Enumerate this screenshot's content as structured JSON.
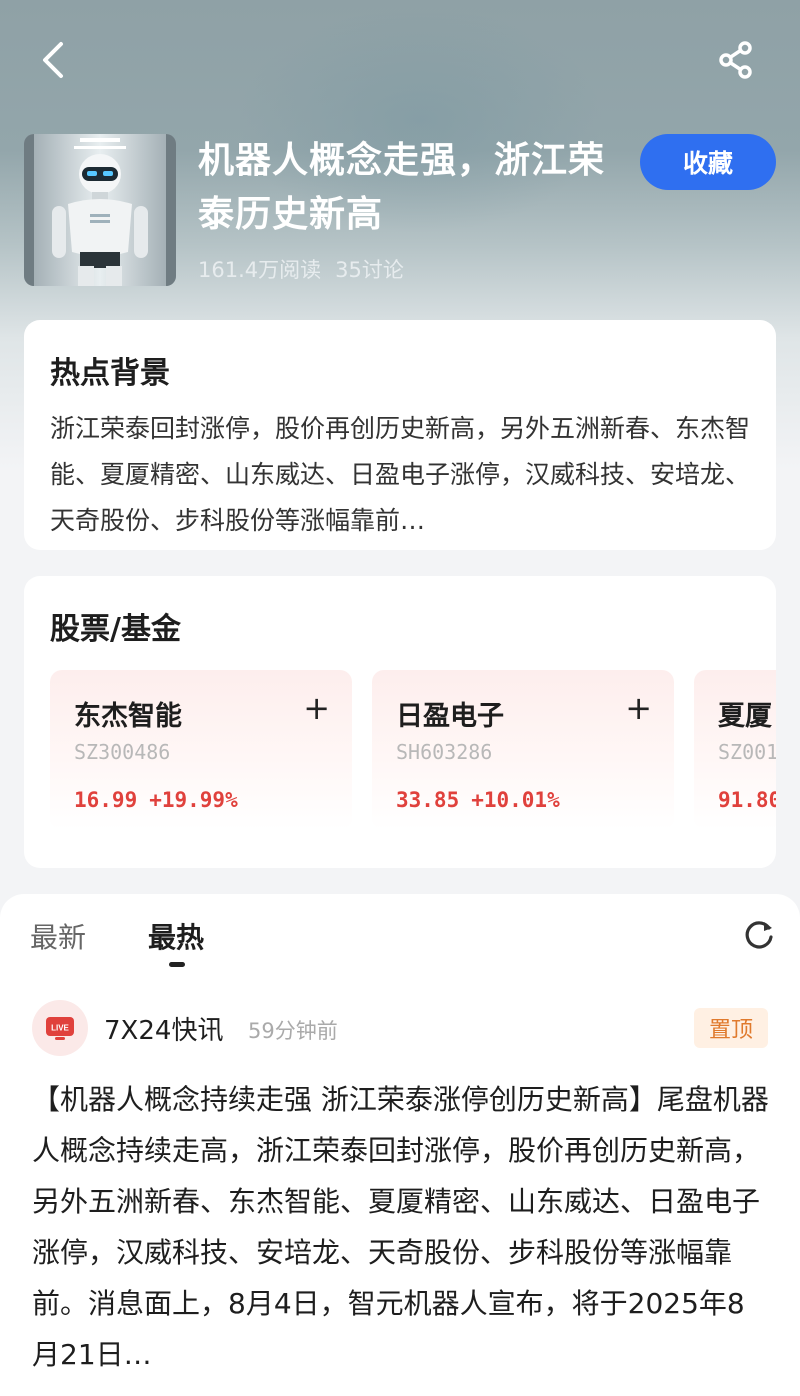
{
  "colors": {
    "accent": "#2f6ff0",
    "stock_up": "#e0413c",
    "pin_text": "#e07a2d",
    "pin_bg": "#fff0e3"
  },
  "header": {
    "back_icon": "chevron-left-icon",
    "share_icon": "share-icon"
  },
  "topic": {
    "title": "机器人概念走强，浙江荣泰历史新高",
    "reads": "161.4万阅读",
    "discussions": "35讨论",
    "favorite_label": "收藏",
    "thumbnail": "robot-image"
  },
  "background_section": {
    "title": "热点背景",
    "text": "浙江荣泰回封涨停，股价再创历史新高，另外五洲新春、东杰智能、夏厦精密、山东威达、日盈电子涨停，汉威科技、安培龙、天奇股份、步科股份等涨幅靠前…"
  },
  "stocks_section": {
    "title": "股票/基金",
    "items": [
      {
        "name": "东杰智能",
        "code": "SZ300486",
        "price": "16.99",
        "change": "+19.99%",
        "add_label": "+"
      },
      {
        "name": "日盈电子",
        "code": "SH603286",
        "price": "33.85",
        "change": "+10.01%",
        "add_label": "+"
      },
      {
        "name": "夏厦",
        "code": "SZ001",
        "price": "91.80",
        "change": "",
        "add_label": "+"
      }
    ]
  },
  "feed": {
    "tabs": [
      {
        "label": "最新",
        "active": false
      },
      {
        "label": "最热",
        "active": true
      }
    ],
    "refresh_icon": "refresh-icon",
    "post": {
      "avatar_label": "LIVE",
      "author": "7X24快讯",
      "time": "59分钟前",
      "badge": "置顶",
      "body": "【机器人概念持续走强 浙江荣泰涨停创历史新高】尾盘机器人概念持续走高，浙江荣泰回封涨停，股价再创历史新高，另外五洲新春、东杰智能、夏厦精密、山东威达、日盈电子涨停，汉威科技、安培龙、天奇股份、步科股份等涨幅靠前。消息面上，8月4日，智元机器人宣布，将于2025年8月21日…"
    }
  }
}
